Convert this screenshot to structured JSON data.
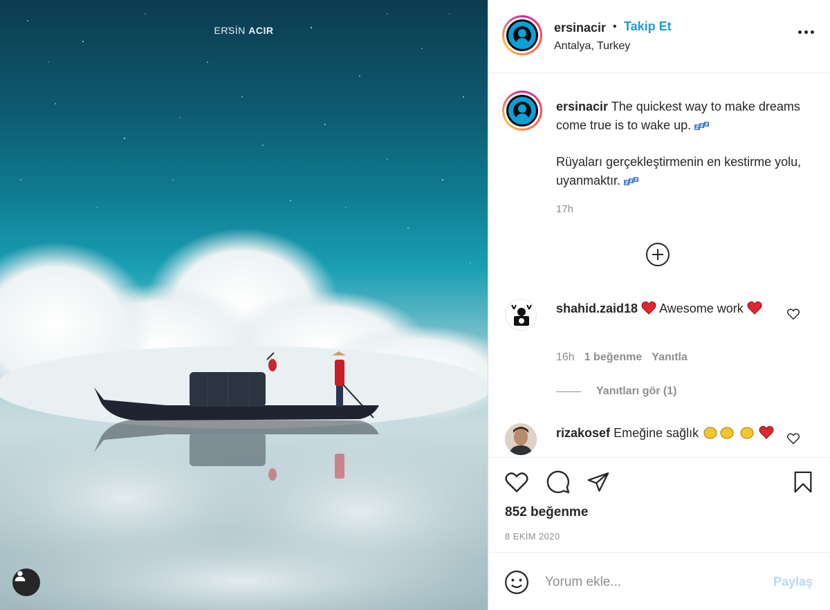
{
  "photo": {
    "credit_first": "ERSİN ",
    "credit_last": "ACIR"
  },
  "header": {
    "username": "ersinacir",
    "separator": "•",
    "follow_label": "Takip Et",
    "location": "Antalya, Turkey"
  },
  "caption": {
    "username": "ersinacir",
    "text_en": "The quickest way to make dreams come true is to wake up.",
    "text_tr": "Rüyaları gerçekleştirmenin en kestirme yolu, uyanmaktır.",
    "time": "17h"
  },
  "comments": [
    {
      "username": "shahid.zaid18",
      "text": "Awesome work",
      "time": "16h",
      "likes": "1 beğenme",
      "reply_label": "Yanıtla",
      "view_replies": "Yanıtları gör (1)"
    },
    {
      "username": "rizakosef",
      "text": "Emeğine sağlık"
    }
  ],
  "stats": {
    "likes": "852 beğenme",
    "date": "8 EKİM 2020"
  },
  "compose": {
    "placeholder": "Yorum ekle...",
    "post_label": "Paylaş"
  },
  "colors": {
    "follow_blue": "#1f9bd8",
    "post_disabled": "#b3dbf2",
    "heart_red": "#ed4956",
    "muted": "#8e8e8e"
  }
}
